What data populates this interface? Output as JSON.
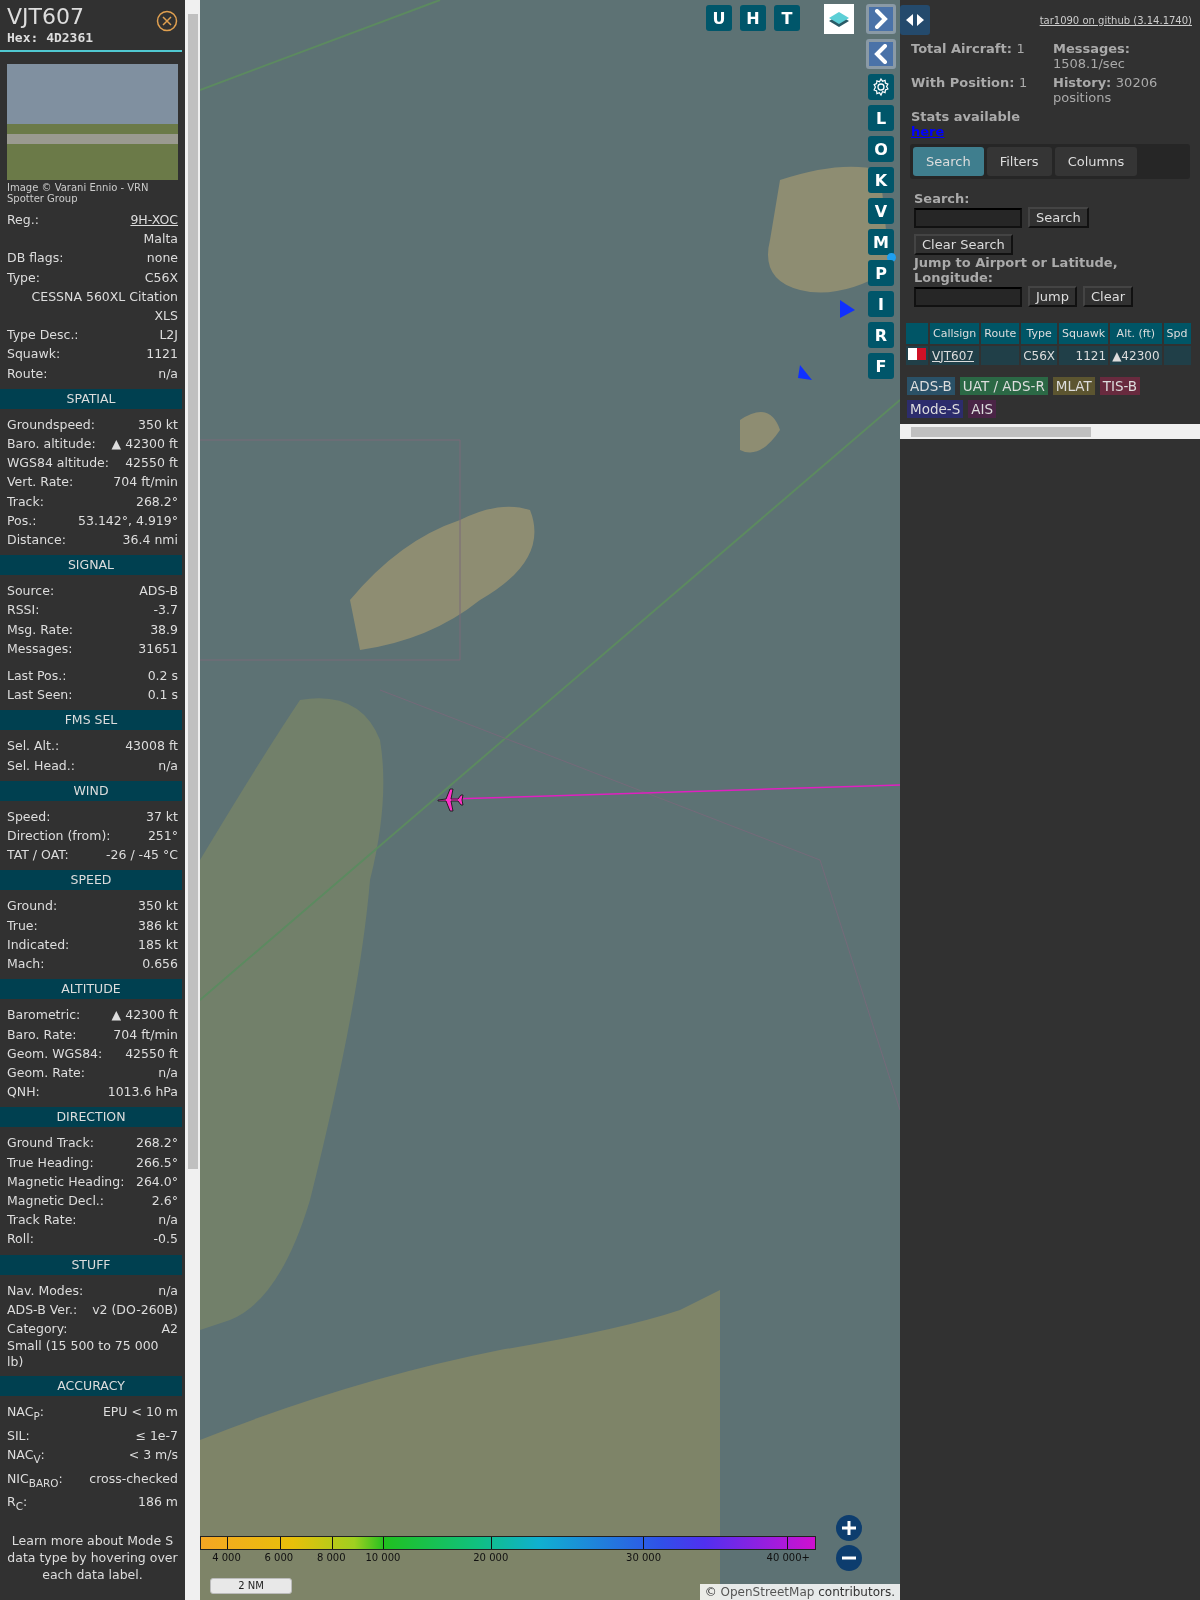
{
  "aircraft": {
    "callsign": "VJT607",
    "hex": "Hex: 4D2361",
    "photo_credit": "Image © Varani Ennio - VRN Spotter Group",
    "info_rows": [
      {
        "kind": "link",
        "label": "Reg.:",
        "value": "9H-XOC"
      },
      {
        "kind": "value_only",
        "value": "Malta"
      },
      {
        "kind": "pair",
        "label": "DB flags:",
        "value": "none"
      },
      {
        "kind": "pair",
        "label": "Type:",
        "value": "C56X"
      },
      {
        "kind": "value_only",
        "value": "CESSNA 560XL Citation XLS"
      },
      {
        "kind": "pair",
        "label": "Type Desc.:",
        "value": "L2J"
      },
      {
        "kind": "pair",
        "label": "Squawk:",
        "value": "1121"
      },
      {
        "kind": "pair",
        "label": "Route:",
        "value": "n/a"
      }
    ],
    "sections": [
      {
        "title": "SPATIAL",
        "groups": [
          [
            {
              "kind": "pair",
              "label": "Groundspeed:",
              "value": "350 kt"
            },
            {
              "kind": "pair",
              "label": "Baro. altitude:",
              "value": "▲ 42300 ft"
            },
            {
              "kind": "pair",
              "label": "WGS84 altitude:",
              "value": "42550 ft"
            },
            {
              "kind": "pair",
              "label": "Vert. Rate:",
              "value": "704 ft/min"
            },
            {
              "kind": "pair",
              "label": "Track:",
              "value": "268.2°"
            },
            {
              "kind": "pair",
              "label": "Pos.:",
              "value": "53.142°, 4.919°"
            },
            {
              "kind": "pair",
              "label": "Distance:",
              "value": "36.4 nmi"
            }
          ]
        ]
      },
      {
        "title": "SIGNAL",
        "groups": [
          [
            {
              "kind": "pair",
              "label": "Source:",
              "value": "ADS-B"
            },
            {
              "kind": "pair",
              "label": "RSSI:",
              "value": "-3.7"
            },
            {
              "kind": "pair",
              "label": "Msg. Rate:",
              "value": "38.9"
            },
            {
              "kind": "pair",
              "label": "Messages:",
              "value": "31651"
            }
          ],
          [
            {
              "kind": "pair",
              "label": "Last Pos.:",
              "value": "0.2 s"
            },
            {
              "kind": "pair",
              "label": "Last Seen:",
              "value": "0.1 s"
            }
          ]
        ]
      },
      {
        "title": "FMS SEL",
        "groups": [
          [
            {
              "kind": "pair",
              "label": "Sel. Alt.:",
              "value": "43008 ft"
            },
            {
              "kind": "pair",
              "label": "Sel. Head.:",
              "value": "n/a"
            }
          ]
        ]
      },
      {
        "title": "WIND",
        "groups": [
          [
            {
              "kind": "pair",
              "label": "Speed:",
              "value": "37 kt"
            },
            {
              "kind": "pair",
              "label": "Direction (from):",
              "value": "251°"
            },
            {
              "kind": "pair",
              "label": "TAT / OAT:",
              "value": "-26 / -45 °C"
            }
          ]
        ]
      },
      {
        "title": "SPEED",
        "groups": [
          [
            {
              "kind": "pair",
              "label": "Ground:",
              "value": "350 kt"
            },
            {
              "kind": "pair",
              "label": "True:",
              "value": "386 kt"
            },
            {
              "kind": "pair",
              "label": "Indicated:",
              "value": "185 kt"
            },
            {
              "kind": "pair",
              "label": "Mach:",
              "value": "0.656"
            }
          ]
        ]
      },
      {
        "title": "ALTITUDE",
        "groups": [
          [
            {
              "kind": "pair",
              "label": "Barometric:",
              "value": "▲ 42300 ft"
            },
            {
              "kind": "pair",
              "label": "Baro. Rate:",
              "value": "704 ft/min"
            },
            {
              "kind": "pair",
              "label": "Geom. WGS84:",
              "value": "42550 ft"
            },
            {
              "kind": "pair",
              "label": "Geom. Rate:",
              "value": "n/a"
            },
            {
              "kind": "pair",
              "label": "QNH:",
              "value": "1013.6 hPa"
            }
          ]
        ]
      },
      {
        "title": "DIRECTION",
        "groups": [
          [
            {
              "kind": "pair",
              "label": "Ground Track:",
              "value": "268.2°"
            },
            {
              "kind": "pair",
              "label": "True Heading:",
              "value": "266.5°"
            },
            {
              "kind": "pair",
              "label": "Magnetic Heading:",
              "value": "264.0°"
            },
            {
              "kind": "pair",
              "label": "Magnetic Decl.:",
              "value": "2.6°"
            },
            {
              "kind": "pair",
              "label": "Track Rate:",
              "value": "n/a"
            },
            {
              "kind": "pair",
              "label": "Roll:",
              "value": "-0.5"
            }
          ]
        ]
      },
      {
        "title": "STUFF",
        "groups": [
          [
            {
              "kind": "pair",
              "label": "Nav. Modes:",
              "value": "n/a"
            },
            {
              "kind": "pair",
              "label": "ADS-B Ver.:",
              "value": "v2 (DO-260B)"
            },
            {
              "kind": "pair",
              "label": "Category:",
              "value": "A2"
            },
            {
              "kind": "note",
              "value": "Small (15 500 to 75 000 lb)"
            }
          ]
        ]
      },
      {
        "title": "ACCURACY",
        "groups": [
          [
            {
              "kind": "pair",
              "label": "NAC$_{P}$:",
              "value": "EPU < 10 m"
            },
            {
              "kind": "pair",
              "label": "SIL:",
              "value": "≤ 1e-7"
            },
            {
              "kind": "pair",
              "label": "NAC$_{V}$:",
              "value": "< 3 m/s"
            },
            {
              "kind": "pair",
              "label": "NIC$_{BARO}$:",
              "value": "cross-checked"
            },
            {
              "kind": "pair",
              "label": "R$_{C}$:",
              "value": "186 m"
            }
          ]
        ]
      }
    ],
    "footer": "Learn more about Mode S data type by hovering over each data label."
  },
  "map": {
    "top_buttons": [
      "U",
      "H",
      "T"
    ],
    "side_buttons": [
      {
        "kind": "arrow_right"
      },
      {
        "kind": "arrow_left"
      },
      {
        "kind": "gear"
      },
      {
        "kind": "letter",
        "label": "L"
      },
      {
        "kind": "letter",
        "label": "O"
      },
      {
        "kind": "letter",
        "label": "K"
      },
      {
        "kind": "letter",
        "label": "V"
      },
      {
        "kind": "letter",
        "label": "M",
        "indicator": true
      },
      {
        "kind": "letter",
        "label": "P"
      },
      {
        "kind": "letter",
        "label": "I"
      },
      {
        "kind": "letter",
        "label": "R"
      },
      {
        "kind": "letter",
        "label": "F"
      }
    ],
    "altitude_legend": [
      "4 000",
      "6 000",
      "8 000",
      "10 000",
      "20 000",
      "30 000",
      "40 000+"
    ],
    "scale": "2 NM",
    "attribution": {
      "prefix": "©",
      "link": "OpenStreetMap",
      "suffix": "contributors."
    }
  },
  "sidebar": {
    "version_link": "tar1090 on github (3.14.1740)",
    "stats": [
      {
        "label": "Total Aircraft:",
        "value": "1"
      },
      {
        "label": "Messages:",
        "value": "1508.1/sec"
      },
      {
        "label": "With Position:",
        "value": "1"
      },
      {
        "label": "History:",
        "value": "30206 positions"
      }
    ],
    "stats_link": {
      "text": "Stats available",
      "link": "here"
    },
    "tabs": [
      {
        "label": "Search",
        "selected": true
      },
      {
        "label": "Filters",
        "selected": false
      },
      {
        "label": "Columns",
        "selected": false
      }
    ],
    "search": {
      "label": "Search:",
      "buttons": [
        "Search",
        "Clear Search"
      ]
    },
    "jump": {
      "label": "Jump to Airport or Latitude, Longitude:",
      "buttons": [
        "Jump",
        "Clear"
      ]
    },
    "table": {
      "columns": [
        {
          "label": "Callsign"
        },
        {
          "label": "Route"
        },
        {
          "label": "Type"
        },
        {
          "label": "Squawk"
        },
        {
          "label": "Alt. (ft)"
        },
        {
          "label": "Spd"
        }
      ],
      "rows": [
        {
          "callsign": "VJT607",
          "type": "C56X",
          "squawk": "1121",
          "altitude": "▲42300"
        }
      ]
    },
    "sources": [
      {
        "label": "ADS-B",
        "color": "#2a5167"
      },
      {
        "label": "UAT / ADS-R",
        "color": "#2b6845"
      },
      {
        "label": "MLAT",
        "color": "#5c5530"
      },
      {
        "label": "TIS-B",
        "color": "#682a3e"
      },
      {
        "label": "Mode-S",
        "color": "#2c2c6c"
      },
      {
        "label": "AIS",
        "color": "#4a2446"
      }
    ]
  }
}
